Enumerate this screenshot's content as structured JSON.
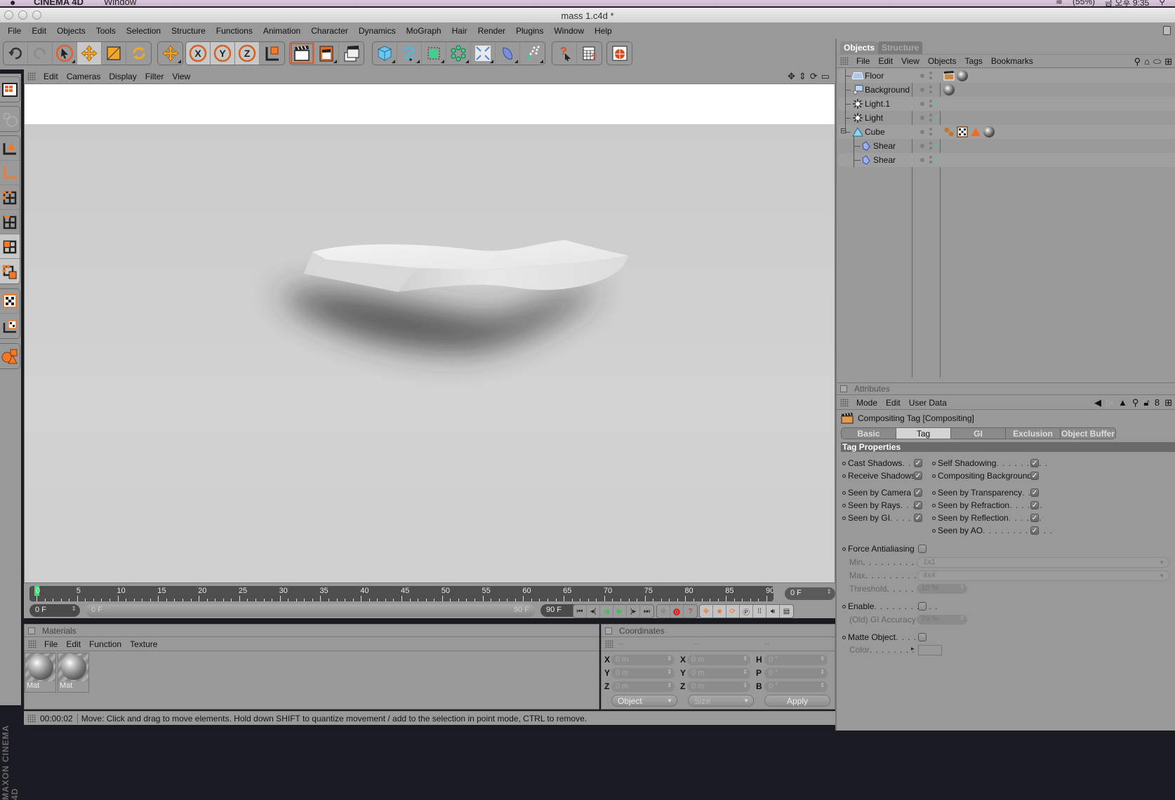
{
  "macbar": {
    "apple": "",
    "app_name": "CINEMA 4D",
    "menu": "Window",
    "battery": "(55%)",
    "clock": "금 오후 9:35"
  },
  "window": {
    "title": "mass 1.c4d *"
  },
  "main_menu": [
    "File",
    "Edit",
    "Objects",
    "Tools",
    "Selection",
    "Structure",
    "Functions",
    "Animation",
    "Character",
    "Dynamics",
    "MoGraph",
    "Hair",
    "Render",
    "Plugins",
    "Window",
    "Help"
  ],
  "toolbar": {
    "groups": [
      [
        "undo-icon",
        "redo-icon",
        "live-selection-icon",
        "move-icon",
        "scale-icon",
        "rotate-icon"
      ],
      [
        "world-coordinates-icon"
      ],
      [
        "x-axis-lock-icon",
        "y-axis-lock-icon",
        "z-axis-lock-icon",
        "coordinate-system-icon"
      ],
      [
        "render-view-icon",
        "render-picture-viewer-icon",
        "render-settings-icon"
      ],
      [
        "cube-primitive-icon",
        "spline-icon",
        "nurbs-icon",
        "array-icon",
        "deformer-icon",
        "scene-object-icon",
        "particle-icon"
      ],
      [
        "help-cursor-icon",
        "command-manager-icon"
      ],
      [
        "web-browser-icon"
      ]
    ],
    "active": [
      "move-icon"
    ]
  },
  "left_toolbar": {
    "groups": [
      [
        "make-editable-icon"
      ],
      [
        "model-globe-icon"
      ],
      [
        "object-axis-icon",
        "axis-mode-icon",
        "points-mode-icon",
        "edges-mode-icon",
        "polygons-mode-icon",
        "selection-mode-icon"
      ],
      [
        "texture-mode-icon",
        "texture-axis-icon"
      ],
      [
        "sculpt-objects-icon"
      ]
    ],
    "active": [
      "polygons-mode-icon",
      "selection-mode-icon"
    ],
    "brand": "MAXON CINEMA 4D"
  },
  "viewport": {
    "menu": [
      "Edit",
      "Cameras",
      "Display",
      "Filter",
      "View"
    ],
    "nav_icons": [
      "pan-icon",
      "dolly-icon",
      "orbit-icon",
      "maximize-icon"
    ]
  },
  "timeline": {
    "start": 0,
    "end": 90,
    "step": 5,
    "current_frame": 0,
    "current_frame_label": "0 F",
    "range_start_label": "0 F",
    "range_end_label": "90 F",
    "min_field": "0 F",
    "max_field": "90 F",
    "playback_buttons": [
      "go-to-start-icon",
      "previous-key-icon",
      "play-backwards-icon",
      "play-forwards-icon",
      "next-key-icon",
      "go-to-end-icon"
    ],
    "record_buttons": [
      "autokey-icon",
      "record-icon",
      "keyframe-selection-icon"
    ],
    "key_buttons": [
      "position-key-icon",
      "scale-key-icon",
      "rotation-key-icon",
      "parameter-key-icon",
      "point-level-icon",
      "sound-icon",
      "timeline-menu-icon"
    ]
  },
  "materials": {
    "title": "Materials",
    "menu": [
      "File",
      "Edit",
      "Function",
      "Texture"
    ],
    "items": [
      {
        "label": "Mat"
      },
      {
        "label": "Mat"
      }
    ]
  },
  "coordinates": {
    "title": "Coordinates",
    "headers": [
      "--",
      "--",
      "--"
    ],
    "position": [
      {
        "axis": "X",
        "value": "0 m"
      },
      {
        "axis": "Y",
        "value": "0 m"
      },
      {
        "axis": "Z",
        "value": "0 m"
      }
    ],
    "size": [
      {
        "axis": "X",
        "value": "0 m"
      },
      {
        "axis": "Y",
        "value": "0 m"
      },
      {
        "axis": "Z",
        "value": "0 m"
      }
    ],
    "rotation": [
      {
        "axis": "H",
        "value": "0 °"
      },
      {
        "axis": "P",
        "value": "0 °"
      },
      {
        "axis": "B",
        "value": "0 °"
      }
    ],
    "mode_select": "Object",
    "size_select": "Size",
    "apply_label": "Apply"
  },
  "status": {
    "time": "00:00:02",
    "message": "Move: Click and drag to move elements. Hold down SHIFT to quantize movement / add to the selection in point mode, CTRL to remove."
  },
  "objects_panel": {
    "tabs": [
      {
        "label": "Objects",
        "active": true
      },
      {
        "label": "Structure",
        "active": false
      }
    ],
    "menu": [
      "File",
      "Edit",
      "View",
      "Objects",
      "Tags",
      "Bookmarks"
    ],
    "right_icons": [
      "search-icon",
      "home-icon",
      "view-toggle-icon",
      "new-panel-icon"
    ],
    "items": [
      {
        "name": "Floor",
        "icon": "floor-icon",
        "depth": 0,
        "enabled_check": false,
        "tags": [
          "compositing-tag-icon",
          "material-tag-icon"
        ]
      },
      {
        "name": "Background",
        "icon": "background-icon",
        "depth": 0,
        "enabled_check": false,
        "tags": [
          "material-tag-icon"
        ]
      },
      {
        "name": "Light.1",
        "icon": "light-icon",
        "depth": 0,
        "enabled_check": true,
        "tags": []
      },
      {
        "name": "Light",
        "icon": "light-icon",
        "depth": 0,
        "enabled_check": true,
        "tags": []
      },
      {
        "name": "Cube",
        "icon": "cube-icon",
        "depth": 0,
        "expanded": true,
        "enabled_check": false,
        "tags": [
          "phong-tag-icon",
          "texture-tag-icon",
          "polygon-tag-icon",
          "material-tag-icon"
        ]
      },
      {
        "name": "Shear",
        "icon": "shear-icon",
        "depth": 1,
        "enabled_check": true,
        "tags": []
      },
      {
        "name": "Shear",
        "icon": "shear-icon",
        "depth": 1,
        "enabled_check": true,
        "tags": []
      }
    ]
  },
  "attributes": {
    "title": "Attributes",
    "menu": [
      "Mode",
      "Edit",
      "User Data"
    ],
    "right_icons": [
      "back-icon",
      "forward-icon",
      "up-icon",
      "search-icon",
      "lock-icon",
      "link-icon",
      "new-panel-icon"
    ],
    "tag_title": "Compositing Tag [Compositing]",
    "tabs": [
      {
        "label": "Basic",
        "active": false
      },
      {
        "label": "Tag",
        "active": true
      },
      {
        "label": "GI",
        "active": false
      },
      {
        "label": "Exclusion",
        "active": false
      },
      {
        "label": "Object Buffer",
        "active": false
      }
    ],
    "section": "Tag Properties",
    "left_props": [
      {
        "label": "Cast Shadows",
        "leader": " . . ",
        "checked": true
      },
      {
        "label": "Receive Shadows",
        "leader": " ",
        "checked": true
      },
      {
        "label": "Seen by Camera",
        "leader": " ",
        "checked": true
      },
      {
        "label": "Seen by Rays",
        "leader": " . . . ",
        "checked": true
      },
      {
        "label": "Seen by GI",
        "leader": " . . . . . ",
        "checked": true
      }
    ],
    "right_props": [
      {
        "label": "Self Shadowing",
        "leader": " . . . . . . . . . ",
        "checked": true
      },
      {
        "label": "Compositing Background",
        "leader": " ",
        "checked": true
      },
      {
        "label": "Seen by Transparency",
        "leader": " . . . ",
        "checked": true
      },
      {
        "label": "Seen by Refraction",
        "leader": " . . . . . . ",
        "checked": true
      },
      {
        "label": "Seen by Reflection",
        "leader": " . . . . . . ",
        "checked": true
      },
      {
        "label": "Seen by AO",
        "leader": " . . . . . . . . . . . . ",
        "checked": true
      }
    ],
    "force_antialiasing": {
      "label": "Force Antialiasing",
      "checked": false
    },
    "min": {
      "label": "Min",
      "leader": " . . . . . . . . . . . . ",
      "value": "1x1"
    },
    "max": {
      "label": "Max",
      "leader": " . . . . . . . . . . . . ",
      "value": "4x4"
    },
    "threshold": {
      "label": "Threshold",
      "leader": ". . . . . . . ",
      "value": "10 %"
    },
    "enable": {
      "label": "Enable",
      "leader": ". . . . . . . . . . . ",
      "checked": false
    },
    "gi_accuracy": {
      "label": "(Old) GI Accuracy",
      "value": "70 %"
    },
    "matte_object": {
      "label": "Matte Object",
      "leader": " . . . . ",
      "checked": false
    },
    "color": {
      "label": "Color",
      "leader": ". . . . . . . . . . "
    }
  },
  "colors": {
    "ui_gray": "#999999",
    "accent_orange": "#f07a2a",
    "playhead_green": "#3fe07a",
    "check_green": "#4fd18a"
  }
}
